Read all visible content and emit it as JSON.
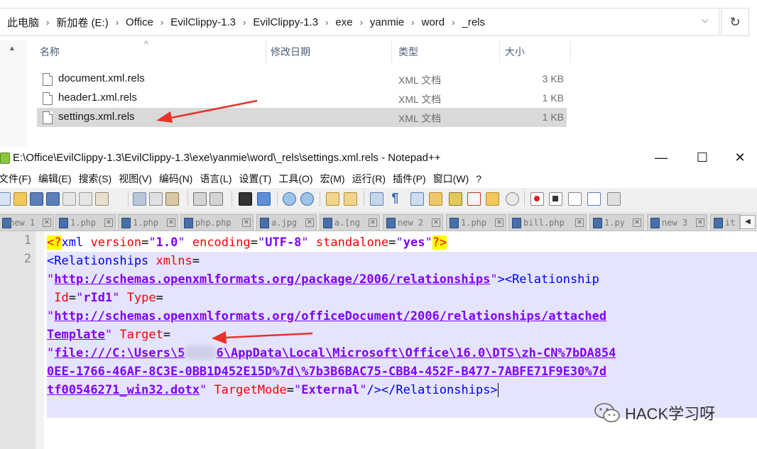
{
  "explorer": {
    "breadcrumbs": [
      "此电脑",
      "新加卷 (E:)",
      "Office",
      "EvilClippy-1.3",
      "EvilClippy-1.3",
      "exe",
      "yanmie",
      "word",
      "_rels"
    ],
    "columns": {
      "name": "名称",
      "date": "修改日期",
      "type": "类型",
      "size": "大小"
    },
    "files": [
      {
        "name": "document.xml.rels",
        "type": "XML 文档",
        "size": "3 KB"
      },
      {
        "name": "header1.xml.rels",
        "type": "XML 文档",
        "size": "1 KB"
      },
      {
        "name": "settings.xml.rels",
        "type": "XML 文档",
        "size": "1 KB",
        "selected": true
      }
    ]
  },
  "notepad": {
    "title": "E:\\Office\\EvilClippy-1.3\\EvilClippy-1.3\\exe\\yanmie\\word\\_rels\\settings.xml.rels - Notepad++",
    "menu": [
      "文件(F)",
      "编辑(E)",
      "搜索(S)",
      "视图(V)",
      "编码(N)",
      "语言(L)",
      "设置(T)",
      "工具(O)",
      "宏(M)",
      "运行(R)",
      "插件(P)",
      "窗口(W)",
      "?"
    ],
    "tabs": [
      "new 1",
      "1.php",
      "1.php",
      "php.php",
      "a.jpg",
      "a.[ng",
      "new 2",
      "1.php",
      "bill.php",
      "1.py",
      "new 3",
      "it"
    ],
    "line_numbers": [
      "1",
      "2"
    ],
    "code": {
      "l1": {
        "lt": "<",
        "q": "?",
        "tag": "xml",
        "a1": "version",
        "v1": "1.0",
        "a2": "encoding",
        "v2": "UTF-8",
        "a3": "standalone",
        "v3": "yes",
        "end": "?>"
      },
      "l2a": {
        "tag": "<Relationships",
        "attr": "xmlns"
      },
      "l2b": {
        "url": "http://schemas.openxmlformats.org/package/2006/relationships",
        "rest": "><Relationship"
      },
      "l2c": {
        "a1": "Id",
        "v1": "rId1",
        "a2": "Type"
      },
      "l2d": {
        "url": "http://schemas.openxmlformats.org/officeDocument/2006/relationships/attached"
      },
      "l2e": {
        "url": "Template",
        "attr": "Target"
      },
      "l2f": {
        "u1": "file:///C:\\Users\\5",
        "u2": "6\\AppData\\Local\\Microsoft\\Office\\16.0\\DTS\\zh-CN%7bDA854"
      },
      "l2g": {
        "url": "0EE-1766-46AF-8C3E-0BB1D452E15D%7d\\%7b3B6BAC75-CBB4-452F-B477-7ABFE71F9E30%7d"
      },
      "l2h": {
        "url": "tf00546271_win32.dotx",
        "attr": "TargetMode",
        "val": "External",
        "close": "/></Relationships>"
      }
    }
  },
  "watermark": {
    "text": "HACK学习呀"
  },
  "colors": {
    "arrow": "#e8322a",
    "selection": "#e4e4ff",
    "accent_purple": "#8000ff"
  }
}
